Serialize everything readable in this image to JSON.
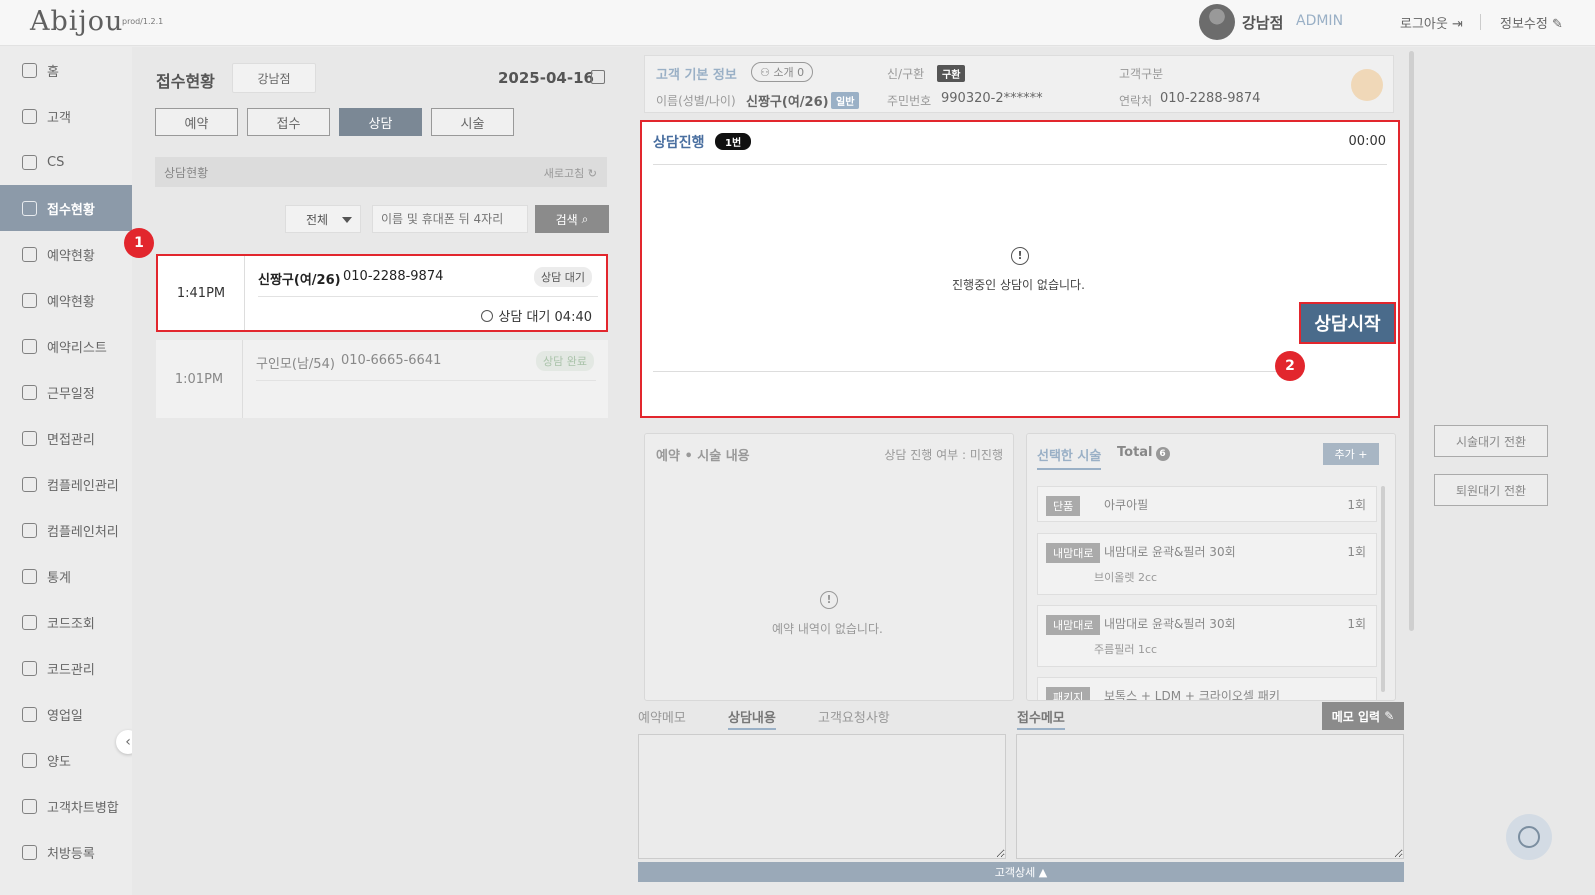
{
  "header": {
    "logo": "Abijou",
    "version": "prod/1.2.1",
    "user_name": "강남점",
    "user_role": "ADMIN",
    "logout": "로그아웃",
    "edit_info": "정보수정"
  },
  "sidebar": {
    "items": [
      {
        "label": "홈"
      },
      {
        "label": "고객"
      },
      {
        "label": "CS"
      },
      {
        "label": "접수현황"
      },
      {
        "label": "예약현황"
      },
      {
        "label": "예약현황"
      },
      {
        "label": "예약리스트"
      },
      {
        "label": "근무일정"
      },
      {
        "label": "면접관리"
      },
      {
        "label": "컴플레인관리"
      },
      {
        "label": "컴플레인처리"
      },
      {
        "label": "통계"
      },
      {
        "label": "코드조회"
      },
      {
        "label": "코드관리"
      },
      {
        "label": "영업일"
      },
      {
        "label": "양도"
      },
      {
        "label": "고객차트병합"
      },
      {
        "label": "처방등록"
      }
    ],
    "active_index": 3,
    "collapse": "‹"
  },
  "reception": {
    "title": "접수현황",
    "branch": "강남점",
    "date": "2025-04-16",
    "tabs": [
      "예약",
      "접수",
      "상담",
      "시술"
    ],
    "active_tab": 2,
    "status_label": "상담현황",
    "refresh_label": "새로고침 ↻",
    "filter": "전체",
    "search_placeholder": "이름 및 휴대폰 뒤 4자리",
    "search_btn": "검색",
    "cards": [
      {
        "time": "1:41PM",
        "name": "신짱구(여/26)",
        "phone": "010-2288-9874",
        "badge": "상담 대기",
        "sub": "상담 대기  04:40"
      },
      {
        "time": "1:01PM",
        "name": "구인모(남/54)",
        "phone": "010-6665-6641",
        "badge": "상담 완료"
      }
    ]
  },
  "customer_info": {
    "section_title": "고객 기본 정보",
    "intro": "소개 0",
    "new_old_label": "신/구환",
    "new_old_value": "구환",
    "category_label": "고객구분",
    "name_label": "이름(성별/나이)",
    "name_value": "신짱구(여/26)",
    "grade": "일반",
    "ssn_label": "주민번호",
    "ssn_value": "990320-2******",
    "contact_label": "연락처",
    "contact_value": "010-2288-9874"
  },
  "consult": {
    "title": "상담진행",
    "number": "1번",
    "timer": "00:00",
    "empty_message": "진행중인 상담이 없습니다.",
    "start_btn": "상담시작"
  },
  "reservation_panel": {
    "title": "예약 • 시술 내용",
    "progress_label": "상담 진행 여부 : 미진행",
    "empty_message": "예약 내역이 없습니다."
  },
  "selected_treatments": {
    "title": "선택한 시술",
    "total_label": "Total",
    "total_count": "6",
    "add_btn": "추가 +",
    "items": [
      {
        "tag": "단품",
        "name": "아쿠아필",
        "count": "1회",
        "sub": ""
      },
      {
        "tag": "내맘대로",
        "name": "내맘대로 윤곽&필러 30회",
        "count": "1회",
        "sub": "브이올렛 2cc"
      },
      {
        "tag": "내맘대로",
        "name": "내맘대로 윤곽&필러 30회",
        "count": "1회",
        "sub": "주름필러 1cc"
      },
      {
        "tag": "패키지",
        "name": "보톡스 + LDM + 크라이오셀 패키",
        "count": "",
        "sub": ""
      }
    ]
  },
  "memo": {
    "tabs": [
      "예약메모",
      "상담내용",
      "고객요청사항"
    ],
    "active_tab": 1,
    "reception_memo_tab": "접수메모",
    "memo_btn": "메모 입력",
    "footer": "고객상세 ▲"
  },
  "actions": {
    "treatment_wait": "시술대기 전환",
    "leave_wait": "퇴원대기 전환"
  },
  "markers": [
    "1",
    "2"
  ],
  "colors": {
    "accent": "#4a6b8b",
    "highlight": "#e2262d",
    "sidebar_active": "#8c9aa9"
  }
}
